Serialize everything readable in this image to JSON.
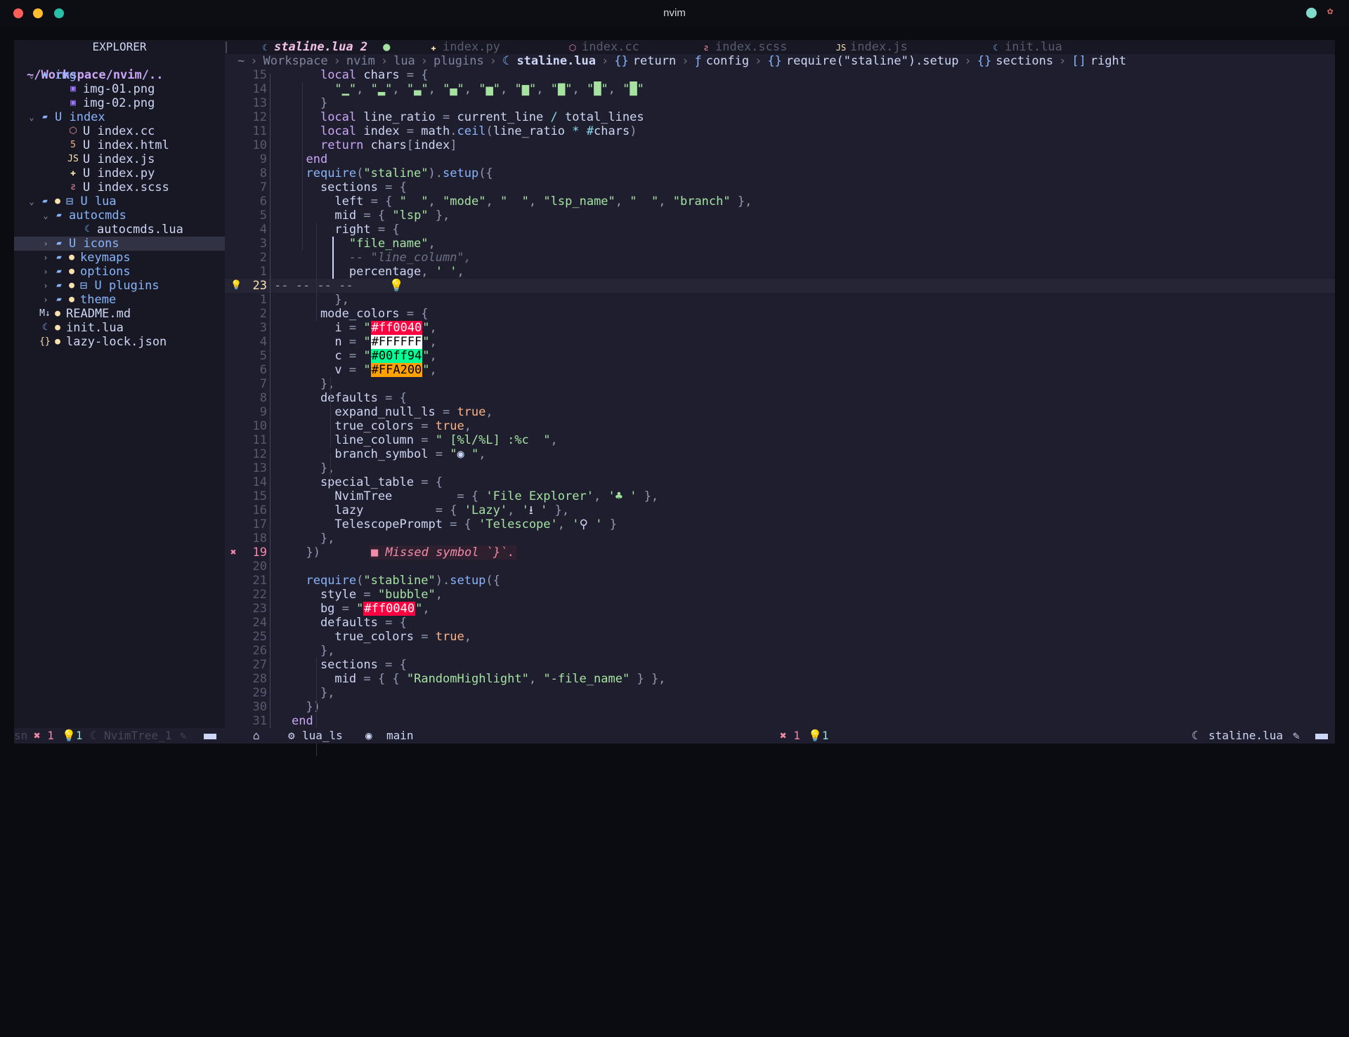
{
  "window": {
    "title": "nvim"
  },
  "explorer": {
    "title": "EXPLORER",
    "root": "~/Workspace/nvim/..",
    "items": [
      {
        "caret": "⌄",
        "icon": "▰",
        "git": "",
        "name": "img",
        "indent": 0,
        "color": "#89b4fa",
        "iconColor": "#89b4fa"
      },
      {
        "caret": "",
        "icon": "▣",
        "git": "",
        "name": "img-01.png",
        "indent": 2,
        "color": "#cdd6f4",
        "iconColor": "#a277ff"
      },
      {
        "caret": "",
        "icon": "▣",
        "git": "",
        "name": "img-02.png",
        "indent": 2,
        "color": "#cdd6f4",
        "iconColor": "#a277ff"
      },
      {
        "caret": "⌄",
        "icon": "▰",
        "git": "",
        "name": "U index",
        "indent": 0,
        "color": "#89b4fa",
        "iconColor": "#89b4fa"
      },
      {
        "caret": "",
        "icon": "⬡",
        "git": "",
        "name": "U index.cc",
        "indent": 2,
        "color": "#cdd6f4",
        "iconColor": "#f38ba8"
      },
      {
        "caret": "",
        "icon": "5",
        "git": "",
        "name": "U index.html",
        "indent": 2,
        "color": "#cdd6f4",
        "iconColor": "#fab387"
      },
      {
        "caret": "",
        "icon": "JS",
        "git": "",
        "name": "U index.js",
        "indent": 2,
        "color": "#cdd6f4",
        "iconColor": "#f9e2af"
      },
      {
        "caret": "",
        "icon": "✚",
        "git": "",
        "name": "U index.py",
        "indent": 2,
        "color": "#cdd6f4",
        "iconColor": "#f9e2af"
      },
      {
        "caret": "",
        "icon": "ƨ",
        "git": "",
        "name": "U index.scss",
        "indent": 2,
        "color": "#cdd6f4",
        "iconColor": "#f38ba8"
      },
      {
        "caret": "⌄",
        "icon": "▰",
        "git": "●",
        "name": "⊟ U lua",
        "indent": 0,
        "color": "#89b4fa",
        "iconColor": "#89b4fa"
      },
      {
        "caret": "⌄",
        "icon": "▰",
        "git": "",
        "name": "autocmds",
        "indent": 1,
        "color": "#89b4fa",
        "iconColor": "#89b4fa"
      },
      {
        "caret": "",
        "icon": "☾",
        "git": "",
        "name": "autocmds.lua",
        "indent": 3,
        "color": "#cdd6f4",
        "iconColor": "#89b4fa"
      },
      {
        "caret": "›",
        "icon": "▰",
        "git": "",
        "name": "U icons",
        "indent": 1,
        "color": "#89b4fa",
        "iconColor": "#89b4fa",
        "selected": true
      },
      {
        "caret": "›",
        "icon": "▰",
        "git": "●",
        "name": "keymaps",
        "indent": 1,
        "color": "#89b4fa",
        "iconColor": "#89b4fa"
      },
      {
        "caret": "›",
        "icon": "▰",
        "git": "●",
        "name": "options",
        "indent": 1,
        "color": "#89b4fa",
        "iconColor": "#89b4fa"
      },
      {
        "caret": "›",
        "icon": "▰",
        "git": "●",
        "name": "⊟ U plugins",
        "indent": 1,
        "color": "#89b4fa",
        "iconColor": "#89b4fa"
      },
      {
        "caret": "›",
        "icon": "▰",
        "git": "●",
        "name": "theme",
        "indent": 1,
        "color": "#89b4fa",
        "iconColor": "#89b4fa"
      },
      {
        "caret": "",
        "icon": "M↓",
        "git": "●",
        "name": "README.md",
        "indent": 0,
        "color": "#cdd6f4",
        "iconColor": "#cdd6f4"
      },
      {
        "caret": "",
        "icon": "☾",
        "git": "●",
        "name": "init.lua",
        "indent": 0,
        "color": "#cdd6f4",
        "iconColor": "#89b4fa"
      },
      {
        "caret": "",
        "icon": "{}",
        "git": "●",
        "name": "lazy-lock.json",
        "indent": 0,
        "color": "#cdd6f4",
        "iconColor": "#f9e2af"
      }
    ]
  },
  "tabs": [
    {
      "icon": "☾",
      "iconColor": "#89b4fa",
      "label": "staline.lua 2",
      "modified": "●",
      "active": true
    },
    {
      "icon": "✚",
      "iconColor": "#f9e2af",
      "label": "index.py"
    },
    {
      "icon": "⬡",
      "iconColor": "#f38ba8",
      "label": "index.cc"
    },
    {
      "icon": "ƨ",
      "iconColor": "#f38ba8",
      "label": "index.scss"
    },
    {
      "icon": "JS",
      "iconColor": "#f9e2af",
      "label": "index.js"
    },
    {
      "icon": "☾",
      "iconColor": "#89b4fa",
      "label": "init.lua"
    }
  ],
  "breadcrumb": {
    "home": "~",
    "parts": [
      "Workspace",
      "nvim",
      "lua",
      "plugins"
    ],
    "file": "staline.lua",
    "symbols": [
      {
        "icon": "{}",
        "label": "return"
      },
      {
        "icon": "ƒ",
        "label": "config"
      },
      {
        "icon": "{}",
        "label": "require(\"staline\").setup"
      },
      {
        "icon": "{}",
        "label": "sections"
      },
      {
        "icon": "[]",
        "label": "right"
      }
    ]
  },
  "editor": {
    "lines": [
      {
        "n": "15",
        "html": "    <span class='k'>local</span> chars <span class='p'>=</span> <span class='p'>{</span>"
      },
      {
        "n": "14",
        "html": "      <span class='s'>\"▁\"</span><span class='p'>,</span> <span class='s'>\"▂\"</span><span class='p'>,</span> <span class='s'>\"▃\"</span><span class='p'>,</span> <span class='s'>\"▄\"</span><span class='p'>,</span> <span class='s'>\"▅\"</span><span class='p'>,</span> <span class='s'>\"▆\"</span><span class='p'>,</span> <span class='s'>\"▇\"</span><span class='p'>,</span> <span class='s'>\"█\"</span><span class='p'>,</span> <span class='s'>\"█\"</span>"
      },
      {
        "n": "13",
        "html": "    <span class='p'>}</span>"
      },
      {
        "n": "12",
        "html": "    <span class='k'>local</span> line_ratio <span class='p'>=</span> current_line <span class='o'>/</span> total_lines"
      },
      {
        "n": "11",
        "html": "    <span class='k'>local</span> index <span class='p'>=</span> math<span class='p'>.</span><span class='f'>ceil</span><span class='p'>(</span>line_ratio <span class='o'>*</span> <span class='o'>#</span>chars<span class='p'>)</span>"
      },
      {
        "n": "10",
        "html": "    <span class='k'>return</span> chars<span class='p'>[</span>index<span class='p'>]</span>"
      },
      {
        "n": "9",
        "html": "  <span class='k'>end</span>"
      },
      {
        "n": "8",
        "html": "  <span class='f'>require</span><span class='p'>(</span><span class='s'>\"staline\"</span><span class='p'>).</span><span class='f'>setup</span><span class='p'>({</span>"
      },
      {
        "n": "7",
        "html": "    sections <span class='p'>=</span> <span class='p'>{</span>"
      },
      {
        "n": "6",
        "html": "      left <span class='p'>=</span> <span class='p'>{</span> <span class='s'>\"  \"</span><span class='p'>,</span> <span class='s'>\"mode\"</span><span class='p'>,</span> <span class='s'>\"  \"</span><span class='p'>,</span> <span class='s'>\"lsp_name\"</span><span class='p'>,</span> <span class='s'>\"  \"</span><span class='p'>,</span> <span class='s'>\"branch\"</span> <span class='p'>},</span>"
      },
      {
        "n": "5",
        "html": "      mid <span class='p'>=</span> <span class='p'>{</span> <span class='s'>\"lsp\"</span> <span class='p'>},</span>"
      },
      {
        "n": "4",
        "html": "      right <span class='p'>=</span> <span class='p'>{</span>"
      },
      {
        "n": "3",
        "html": "        <span class='s'>\"file_name\"</span><span class='p'>,</span>"
      },
      {
        "n": "2",
        "html": "        <span class='c'>-- \"line_column\",</span>"
      },
      {
        "n": "1",
        "html": "        percentage<span class='p'>,</span> <span class='s'>' '</span><span class='p'>,</span>"
      },
      {
        "n": "23",
        "html": "<span class='p'>-- -- -- --</span>     <span class='b'>💡</span>",
        "cursor": true
      },
      {
        "n": "1",
        "html": "      <span class='p'>},</span>"
      },
      {
        "n": "2",
        "html": "    mode_colors <span class='p'>=</span> <span class='p'>{</span>"
      },
      {
        "n": "3",
        "html": "      i <span class='p'>=</span> <span class='s'>\"</span><span class='hl' style='background:#ff0040;color:#ffffff'>#ff0040</span><span class='s'>\"</span><span class='p'>,</span>"
      },
      {
        "n": "4",
        "html": "      n <span class='p'>=</span> <span class='s'>\"</span><span class='hl' style='background:#ffffff;color:#000000'>#FFFFFF</span><span class='s'>\"</span><span class='p'>,</span>"
      },
      {
        "n": "5",
        "html": "      c <span class='p'>=</span> <span class='s'>\"</span><span class='hl' style='background:#00ff94;color:#000000'>#00ff94</span><span class='s'>\"</span><span class='p'>,</span>"
      },
      {
        "n": "6",
        "html": "      v <span class='p'>=</span> <span class='s'>\"</span><span class='hl' style='background:#ffa200;color:#000000'>#FFA200</span><span class='s'>\"</span><span class='p'>,</span>"
      },
      {
        "n": "7",
        "html": "    <span class='p'>},</span>"
      },
      {
        "n": "8",
        "html": "    defaults <span class='p'>=</span> <span class='p'>{</span>"
      },
      {
        "n": "9",
        "html": "      expand_null_ls <span class='p'>=</span> <span class='b'>true</span><span class='p'>,</span>"
      },
      {
        "n": "10",
        "html": "      true_colors <span class='p'>=</span> <span class='b'>true</span><span class='p'>,</span>"
      },
      {
        "n": "11",
        "html": "      line_column <span class='p'>=</span> <span class='s'>\" [%l/%L] :%c  \"</span><span class='p'>,</span>"
      },
      {
        "n": "12",
        "html": "      branch_symbol <span class='p'>=</span> <span class='s'>\"</span><span class='fg'>◉</span> <span class='s'>\"</span><span class='p'>,</span>"
      },
      {
        "n": "13",
        "html": "    <span class='p'>},</span>"
      },
      {
        "n": "14",
        "html": "    special_table <span class='p'>=</span> <span class='p'>{</span>"
      },
      {
        "n": "15",
        "html": "      NvimTree         <span class='p'>=</span> <span class='p'>{</span> <span class='s'>'File Explorer'</span><span class='p'>,</span> <span class='s'>'</span><span class='s'>♣</span> <span class='s'>'</span> <span class='p'>},</span>"
      },
      {
        "n": "16",
        "html": "      lazy          <span class='p'>=</span> <span class='p'>{</span> <span class='s'>'Lazy'</span><span class='p'>,</span> <span class='s'>'</span><span class='fg'>⭳</span> <span class='s'>'</span> <span class='p'>},</span>"
      },
      {
        "n": "17",
        "html": "      TelescopePrompt <span class='p'>=</span> <span class='p'>{</span> <span class='s'>'Telescope'</span><span class='p'>,</span> <span class='s'>'</span><span class='fg'>⚲</span> <span class='s'>'</span> <span class='p'>}</span>"
      },
      {
        "n": "18",
        "html": "    <span class='p'>},</span>"
      },
      {
        "n": "19",
        "html": "  <span class='p'>})</span>",
        "error": true
      },
      {
        "n": "20",
        "html": ""
      },
      {
        "n": "21",
        "html": "  <span class='f'>require</span><span class='p'>(</span><span class='s'>\"stabline\"</span><span class='p'>).</span><span class='f'>setup</span><span class='p'>({</span>"
      },
      {
        "n": "22",
        "html": "    style <span class='p'>=</span> <span class='s'>\"bubble\"</span><span class='p'>,</span>"
      },
      {
        "n": "23",
        "html": "    bg <span class='p'>=</span> <span class='s'>\"</span><span class='hl' style='background:#ff0040;color:#ffffff'>#ff0040</span><span class='s'>\"</span><span class='p'>,</span>"
      },
      {
        "n": "24",
        "html": "    defaults <span class='p'>=</span> <span class='p'>{</span>"
      },
      {
        "n": "25",
        "html": "      true_colors <span class='p'>=</span> <span class='b'>true</span><span class='p'>,</span>"
      },
      {
        "n": "26",
        "html": "    <span class='p'>},</span>"
      },
      {
        "n": "27",
        "html": "    sections <span class='p'>=</span> <span class='p'>{</span>"
      },
      {
        "n": "28",
        "html": "      mid <span class='p'>=</span> <span class='p'>{</span> <span class='p'>{</span> <span class='s'>\"RandomHighlight\"</span><span class='p'>,</span> <span class='s'>\"-file_name\"</span> <span class='p'>}</span> <span class='p'>},</span>"
      },
      {
        "n": "29",
        "html": "    <span class='p'>},</span>"
      },
      {
        "n": "30",
        "html": "  <span class='p'>})</span>"
      },
      {
        "n": "31",
        "html": "<span class='k'>end</span>"
      }
    ],
    "diagnostic": "■ Missed symbol `}`."
  },
  "status": {
    "left_mode": "sn",
    "errors_left": "✖ 1",
    "hints_left": "💡1",
    "left_buf": "NvimTree_1",
    "lsp": "lua_ls",
    "branch": "main",
    "errors": "✖ 1",
    "hints": "💡1",
    "file": "staline.lua"
  },
  "colors": {
    "accent": "#89b4fa",
    "error": "#f38ba8",
    "warning": "#f9e2af",
    "bg": "#1e1e2e",
    "sidebar_bg": "#181825"
  }
}
